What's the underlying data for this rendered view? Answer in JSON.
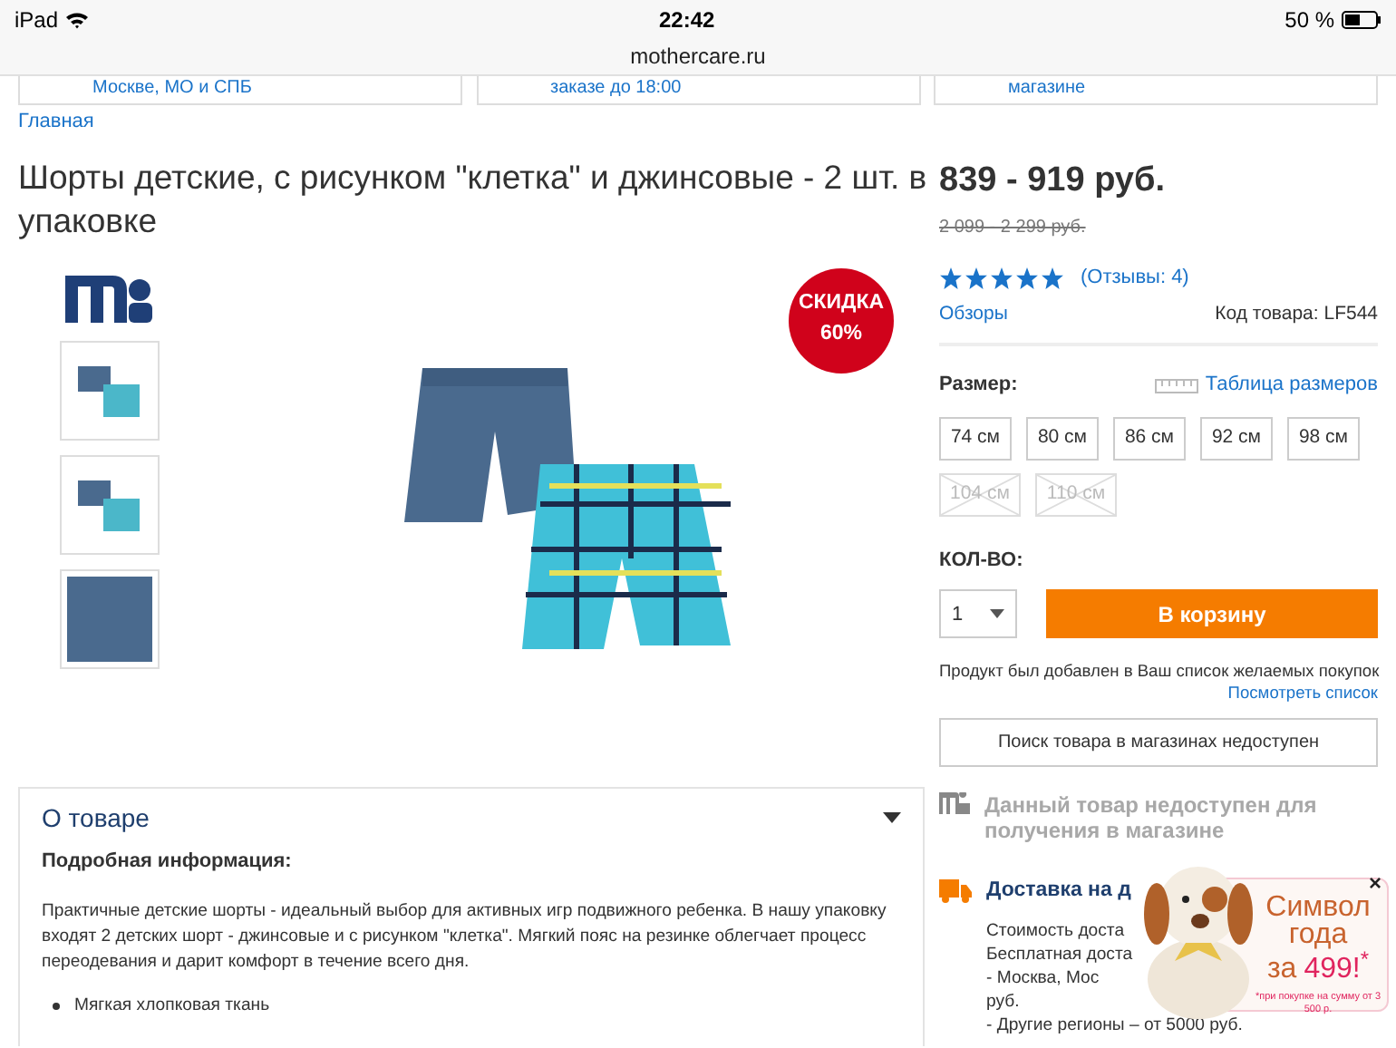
{
  "status_bar": {
    "device": "iPad",
    "time": "22:42",
    "battery": "50 %"
  },
  "address_bar": {
    "url": "mothercare.ru"
  },
  "promo_banners": [
    {
      "text": "Москве, МО и СПБ"
    },
    {
      "text": "заказе до 18:00"
    },
    {
      "text": "магазине"
    }
  ],
  "breadcrumb": [
    "Главная"
  ],
  "product": {
    "title": "Шорты детские, с рисунком \"клетка\" и джинсовые - 2 шт. в упаковке",
    "discount_badge": [
      "СКИДКА",
      "60%"
    ],
    "thumbnails": [
      {
        "selected": false
      },
      {
        "selected": false
      },
      {
        "selected": false
      }
    ]
  },
  "about": {
    "title": "О товаре",
    "expanded": true,
    "subtitle": "Подробная информация:",
    "description": "Практичные детские шорты - идеальный выбор для активных игр подвижного ребенка. В нашу упаковку входят 2 детских шорт - джинсовые и с рисунком \"клетка\". Мягкий пояс на резинке облегчает процесс переодевания и дарит комфорт в течение всего дня.",
    "bullets": [
      "Мягкая хлопковая ткань"
    ]
  },
  "buy_box": {
    "price": "839 - 919 руб.",
    "old_price": "2 099 - 2 299 руб.",
    "stars": 5,
    "reviews_link": "(Отзывы: 4)",
    "reviews_tab": "Обзоры",
    "sku": "Код товара: LF544",
    "size_label": "Размер:",
    "size_chart_link": "Таблица размеров",
    "sizes": [
      {
        "label": "74 см",
        "disabled": false
      },
      {
        "label": "80 см",
        "disabled": false
      },
      {
        "label": "86 см",
        "disabled": false
      },
      {
        "label": "92 см",
        "disabled": false
      },
      {
        "label": "98 см",
        "disabled": false
      },
      {
        "label": "104 см",
        "disabled": true
      },
      {
        "label": "110 см",
        "disabled": true
      }
    ],
    "qty_label": "КОЛ-ВО:",
    "qty_value": "1",
    "cart_button": "В корзину",
    "wishlist_note": "Продукт был добавлен в Ваш список желаемых покупок",
    "wishlist_link": "Посмотреть список",
    "store_search_button": "Поиск товара в магазинах недоступен",
    "store_pickup_note": "Данный товар недоступен для получения в магазине",
    "delivery_title": "Доставка на д",
    "delivery_lines": [
      "Стоимость доста",
      "Бесплатная доста",
      "- Москва, Мос",
      "руб.",
      "- Другие регионы – от 5000 руб."
    ]
  },
  "popup": {
    "title_lines": [
      "Символ",
      "года"
    ],
    "prefix": "за",
    "price": "499!$^{*}$",
    "note": "*при покупке на сумму от 3 500 р.",
    "close": "×"
  }
}
